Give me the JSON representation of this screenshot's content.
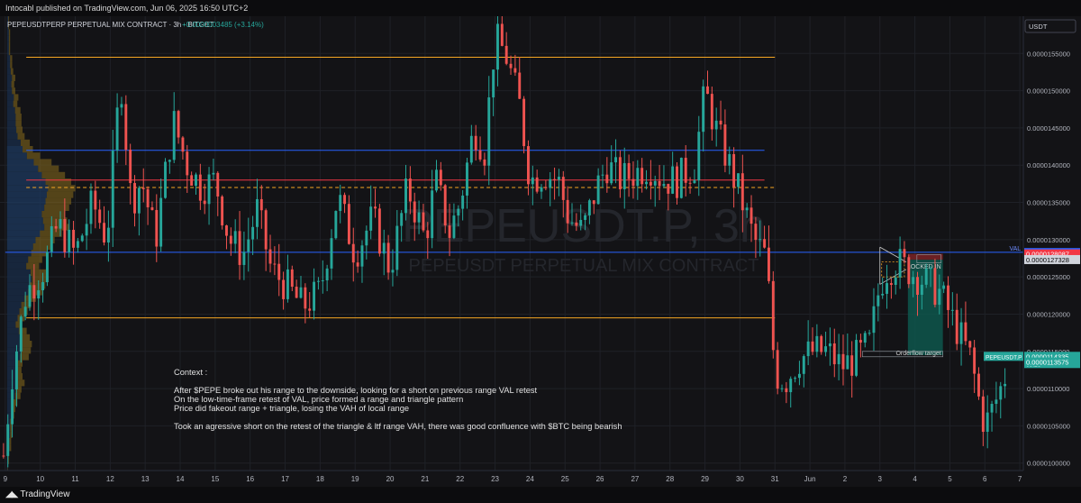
{
  "header": {
    "published": "Intocabl published on TradingView.com, Jun 06, 2025 16:50 UTC+2"
  },
  "symbol_info": {
    "title": "PEPEUSDTPERP PERPETUAL MIX CONTRACT · 3h · BITGET",
    "change": "+0.0000003485 (+3.14%)"
  },
  "watermark": {
    "main": "PEPEUSDT.P, 3h",
    "sub": "PEPEUSDT PERPETUAL MIX CONTRACT"
  },
  "currency_label": "USDT",
  "footer": {
    "brand": "TradingView"
  },
  "colors": {
    "up": "#26a69a",
    "down": "#ef5350",
    "range_high": "#f5a623",
    "blue_level": "#2962ff",
    "red_level": "#f23645",
    "profile_fill": "#8a6d1e",
    "value_area_fill": "#1e3a5f",
    "target_box": "#0e5b50",
    "stop_box": "#7a2326"
  },
  "chart_data": {
    "type": "candlestick",
    "ylim": [
      9.9e-06,
      1.6e-05
    ],
    "xlim": [
      8.85,
      38.1
    ],
    "y_ticks": [
      "0.0000100000",
      "0.0000105000",
      "0.0000110000",
      "0.0000115000",
      "0.0000120000",
      "0.0000125000",
      "0.0000130000",
      "0.0000135000",
      "0.0000140000",
      "0.0000145000",
      "0.0000150000",
      "0.0000155000"
    ],
    "x_ticks": [
      {
        "x": 9,
        "label": "9"
      },
      {
        "x": 10,
        "label": "10"
      },
      {
        "x": 11,
        "label": "11"
      },
      {
        "x": 12,
        "label": "12"
      },
      {
        "x": 13,
        "label": "13"
      },
      {
        "x": 14,
        "label": "14"
      },
      {
        "x": 15,
        "label": "15"
      },
      {
        "x": 16,
        "label": "16"
      },
      {
        "x": 17,
        "label": "17"
      },
      {
        "x": 18,
        "label": "18"
      },
      {
        "x": 19,
        "label": "19"
      },
      {
        "x": 20,
        "label": "20"
      },
      {
        "x": 21,
        "label": "21"
      },
      {
        "x": 22,
        "label": "22"
      },
      {
        "x": 23,
        "label": "23"
      },
      {
        "x": 24,
        "label": "24"
      },
      {
        "x": 25,
        "label": "25"
      },
      {
        "x": 26,
        "label": "26"
      },
      {
        "x": 27,
        "label": "27"
      },
      {
        "x": 28,
        "label": "28"
      },
      {
        "x": 29,
        "label": "29"
      },
      {
        "x": 30,
        "label": "30"
      },
      {
        "x": 31,
        "label": "31"
      },
      {
        "x": 32,
        "label": "Jun"
      },
      {
        "x": 33,
        "label": "2"
      },
      {
        "x": 34,
        "label": "3"
      },
      {
        "x": 35,
        "label": "4"
      },
      {
        "x": 36,
        "label": "5"
      },
      {
        "x": 37,
        "label": "6"
      },
      {
        "x": 38,
        "label": "7"
      }
    ],
    "anchors": [
      [
        8.95,
        1.01e-05
      ],
      [
        9.2,
        1.12e-05
      ],
      [
        9.6,
        1.23e-05
      ],
      [
        10.1,
        1.26e-05
      ],
      [
        10.5,
        1.32e-05
      ],
      [
        11.0,
        1.28e-05
      ],
      [
        11.5,
        1.35e-05
      ],
      [
        11.9,
        1.3e-05
      ],
      [
        12.3,
        1.52e-05
      ],
      [
        12.6,
        1.35e-05
      ],
      [
        12.9,
        1.38e-05
      ],
      [
        13.3,
        1.3e-05
      ],
      [
        13.8,
        1.46e-05
      ],
      [
        14.2,
        1.4e-05
      ],
      [
        14.6,
        1.37e-05
      ],
      [
        15.0,
        1.38e-05
      ],
      [
        15.4,
        1.3e-05
      ],
      [
        15.8,
        1.28e-05
      ],
      [
        16.2,
        1.34e-05
      ],
      [
        16.6,
        1.26e-05
      ],
      [
        17.0,
        1.24e-05
      ],
      [
        17.5,
        1.21e-05
      ],
      [
        18.0,
        1.23e-05
      ],
      [
        18.5,
        1.36e-05
      ],
      [
        19.0,
        1.28e-05
      ],
      [
        19.5,
        1.33e-05
      ],
      [
        20.0,
        1.26e-05
      ],
      [
        20.5,
        1.37e-05
      ],
      [
        21.0,
        1.3e-05
      ],
      [
        21.3,
        1.38e-05
      ],
      [
        21.7,
        1.31e-05
      ],
      [
        22.0,
        1.35e-05
      ],
      [
        22.4,
        1.45e-05
      ],
      [
        22.7,
        1.42e-05
      ],
      [
        23.0,
        1.57e-05
      ],
      [
        23.3,
        1.55e-05
      ],
      [
        23.7,
        1.48e-05
      ],
      [
        24.0,
        1.38e-05
      ],
      [
        24.4,
        1.39e-05
      ],
      [
        24.8,
        1.38e-05
      ],
      [
        25.1,
        1.33e-05
      ],
      [
        25.5,
        1.31e-05
      ],
      [
        25.9,
        1.37e-05
      ],
      [
        26.2,
        1.4e-05
      ],
      [
        26.6,
        1.38e-05
      ],
      [
        27.0,
        1.39e-05
      ],
      [
        27.4,
        1.4e-05
      ],
      [
        27.8,
        1.38e-05
      ],
      [
        28.2,
        1.38e-05
      ],
      [
        28.7,
        1.4e-05
      ],
      [
        29.0,
        1.5e-05
      ],
      [
        29.3,
        1.45e-05
      ],
      [
        29.7,
        1.4e-05
      ],
      [
        30.0,
        1.36e-05
      ],
      [
        30.4,
        1.3e-05
      ],
      [
        30.7,
        1.28e-05
      ],
      [
        30.85,
        1.22e-05
      ],
      [
        31.0,
        1.12e-05
      ],
      [
        31.3,
        1.11e-05
      ],
      [
        31.7,
        1.14e-05
      ],
      [
        32.1,
        1.15e-05
      ],
      [
        32.5,
        1.15e-05
      ],
      [
        32.9,
        1.13e-05
      ],
      [
        33.3,
        1.14e-05
      ],
      [
        33.7,
        1.16e-05
      ],
      [
        34.0,
        1.24e-05
      ],
      [
        34.2,
        1.26e-05
      ],
      [
        34.5,
        1.27e-05
      ],
      [
        34.8,
        1.26e-05
      ],
      [
        35.1,
        1.25e-05
      ],
      [
        35.4,
        1.24e-05
      ],
      [
        35.7,
        1.23e-05
      ],
      [
        36.0,
        1.2e-05
      ],
      [
        36.3,
        1.17e-05
      ],
      [
        36.6,
        1.14e-05
      ],
      [
        36.85,
        1.08e-05
      ],
      [
        37.0,
        1.05e-05
      ],
      [
        37.2,
        1.07e-05
      ],
      [
        37.45,
        1.1e-05
      ],
      [
        37.6,
        1.12e-05
      ]
    ],
    "levels": [
      {
        "name": "Range high",
        "price": 1.545e-05,
        "x_from": 9.6,
        "x_to": 31.0,
        "color": "#f5a623",
        "style": "solid"
      },
      {
        "name": "Range low",
        "price": 1.195e-05,
        "x_from": 9.6,
        "x_to": 31.0,
        "color": "#f5a623",
        "style": "solid"
      },
      {
        "name": "Blue upper",
        "price": 1.42e-05,
        "x_from": 9.6,
        "x_to": 30.7,
        "color": "#2962ff",
        "style": "solid"
      },
      {
        "name": "Red POC",
        "price": 1.38e-05,
        "x_from": 9.6,
        "x_to": 30.7,
        "color": "#f23645",
        "style": "solid"
      },
      {
        "name": "Dashed mid",
        "price": 1.37e-05,
        "x_from": 9.6,
        "x_to": 31.0,
        "color": "#f5a623",
        "style": "dashed"
      },
      {
        "name": "VAL",
        "price": 1.283e-05,
        "x_from": 9.0,
        "x_to": 38.1,
        "color": "#2962ff",
        "style": "solid"
      }
    ],
    "position": {
      "x_from": 34.8,
      "x_to": 35.8,
      "entry": 1.273e-05,
      "stop": 1.281e-05,
      "target": 1.145e-05
    },
    "price_tags": [
      {
        "price": 1.2827e-05,
        "label": "0.0000128270",
        "bg": "#2962ff",
        "fg": "#ffffff"
      },
      {
        "price": 1.28087e-05,
        "label": "0.0000128087",
        "bg": "#f23645",
        "fg": "#ffffff"
      },
      {
        "price": 1.27328e-05,
        "label": "0.0000127328",
        "bg": "#d1d4dc",
        "fg": "#000000"
      },
      {
        "price": 1.14335e-05,
        "label": "0.0000114335",
        "bg": "#26a69a",
        "fg": "#ffffff",
        "sub": "09:26"
      },
      {
        "price": 1.13575e-05,
        "label": "0.0000113575",
        "bg": "#26a69a",
        "fg": "#ffffff"
      }
    ],
    "current_symbol_tag": "PEPEUSDT.P",
    "val_tag": "VAL",
    "locked_in": "LOCKED IN",
    "orderflow_target": "Orderflow target",
    "annotation": [
      "Context :",
      "",
      "After $PEPE broke out his range to the downside, looking for a short on previous range VAL retest",
      "On the low-time-frame retest of VAL, price formed a range and triangle pattern",
      "Price did fakeout range + triangle, losing the VAH of local range",
      "",
      "Took an agressive short on the retest of the triangle & ltf range VAH, there was good confluence with $BTC being bearish"
    ]
  }
}
